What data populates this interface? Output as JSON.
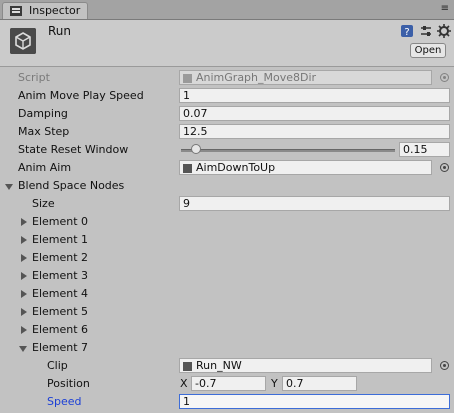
{
  "tab": {
    "label": "Inspector",
    "menu": "≡"
  },
  "header": {
    "object_name": "Run",
    "open_label": "Open"
  },
  "fields": {
    "script": {
      "label": "Script",
      "value": "AnimGraph_Move8Dir"
    },
    "anim_move_play_speed": {
      "label": "Anim Move Play Speed",
      "value": "1"
    },
    "damping": {
      "label": "Damping",
      "value": "0.07"
    },
    "max_step": {
      "label": "Max Step",
      "value": "12.5"
    },
    "state_reset_window": {
      "label": "State Reset Window",
      "value": "0.15",
      "slider_fraction": 0.07
    },
    "anim_aim": {
      "label": "Anim Aim",
      "value": "AimDownToUp"
    }
  },
  "blend_space_nodes": {
    "label": "Blend Space Nodes",
    "size_label": "Size",
    "size_value": "9",
    "collapsed_elements": [
      "Element 0",
      "Element 1",
      "Element 2",
      "Element 3",
      "Element 4",
      "Element 5",
      "Element 6"
    ],
    "expanded_element": {
      "label": "Element 7",
      "clip_label": "Clip",
      "clip_value": "Run_NW",
      "position_label": "Position",
      "x_label": "X",
      "x_value": "-0.7",
      "y_label": "Y",
      "y_value": "0.7",
      "speed_label": "Speed",
      "speed_value": "1"
    }
  },
  "colors": {
    "highlight_label": "#1b3fd6",
    "focus_border": "#3d6dd8",
    "panel": "#c2c2c2"
  }
}
